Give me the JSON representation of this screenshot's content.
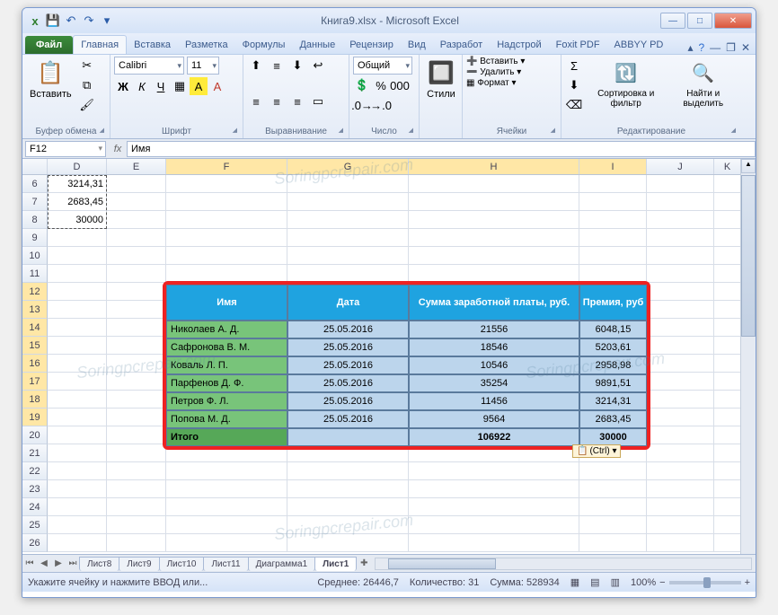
{
  "window": {
    "title": "Книга9.xlsx - Microsoft Excel"
  },
  "qat": {
    "excel": "x",
    "save": "💾",
    "undo": "↶",
    "redo": "↷",
    "dd": "▾"
  },
  "tabs": {
    "file": "Файл",
    "items": [
      "Главная",
      "Вставка",
      "Разметка",
      "Формулы",
      "Данные",
      "Рецензир",
      "Вид",
      "Разработ",
      "Надстрой",
      "Foxit PDF",
      "ABBYY PD"
    ],
    "active": 0
  },
  "ribbon": {
    "clipboard": {
      "label": "Буфер обмена",
      "paste": "Вставить"
    },
    "font": {
      "label": "Шрифт",
      "name": "Calibri",
      "size": "11",
      "bold": "Ж",
      "italic": "К",
      "underline": "Ч"
    },
    "align": {
      "label": "Выравнивание"
    },
    "number": {
      "label": "Число",
      "format": "Общий"
    },
    "styles": {
      "label": "Стили"
    },
    "cells": {
      "label": "Ячейки",
      "insert": "Вставить",
      "delete": "Удалить",
      "format": "Формат"
    },
    "editing": {
      "label": "Редактирование",
      "sort": "Сортировка и фильтр",
      "find": "Найти и выделить"
    }
  },
  "formula_bar": {
    "cell_ref": "F12",
    "value": "Имя"
  },
  "columns": [
    "D",
    "E",
    "F",
    "G",
    "H",
    "I",
    "J",
    "K"
  ],
  "selected_cols": [
    "F",
    "G",
    "H",
    "I"
  ],
  "rows_visible": [
    6,
    7,
    8,
    9,
    10,
    11,
    12,
    13,
    14,
    15,
    16,
    17,
    18,
    19,
    20,
    21,
    22,
    23,
    24,
    25,
    26
  ],
  "selected_rows": [
    12,
    13,
    14,
    15,
    16,
    17,
    18,
    19
  ],
  "clipboard_cells": {
    "6": "3214,31",
    "7": "2683,45",
    "8": "30000"
  },
  "table": {
    "headers": [
      "Имя",
      "Дата",
      "Сумма заработной платы, руб.",
      "Премия, руб"
    ],
    "rows": [
      [
        "Николаев А. Д.",
        "25.05.2016",
        "21556",
        "6048,15"
      ],
      [
        "Сафронова В. М.",
        "25.05.2016",
        "18546",
        "5203,61"
      ],
      [
        "Коваль Л. П.",
        "25.05.2016",
        "10546",
        "2958,98"
      ],
      [
        "Парфенов Д. Ф.",
        "25.05.2016",
        "35254",
        "9891,51"
      ],
      [
        "Петров Ф. Л.",
        "25.05.2016",
        "11456",
        "3214,31"
      ],
      [
        "Попова М. Д.",
        "25.05.2016",
        "9564",
        "2683,45"
      ]
    ],
    "total": [
      "Итого",
      "",
      "106922",
      "30000"
    ]
  },
  "smart_tag": "(Ctrl) ▾",
  "sheets": {
    "items": [
      "Лист8",
      "Лист9",
      "Лист10",
      "Лист11",
      "Диаграмма1",
      "Лист1"
    ],
    "active": 5
  },
  "status": {
    "mode": "Укажите ячейку и нажмите ВВОД или...",
    "avg_label": "Среднее:",
    "avg": "26446,7",
    "count_label": "Количество:",
    "count": "31",
    "sum_label": "Сумма:",
    "sum": "528934",
    "zoom": "100%"
  },
  "watermark": "Soringpcrepair.com"
}
